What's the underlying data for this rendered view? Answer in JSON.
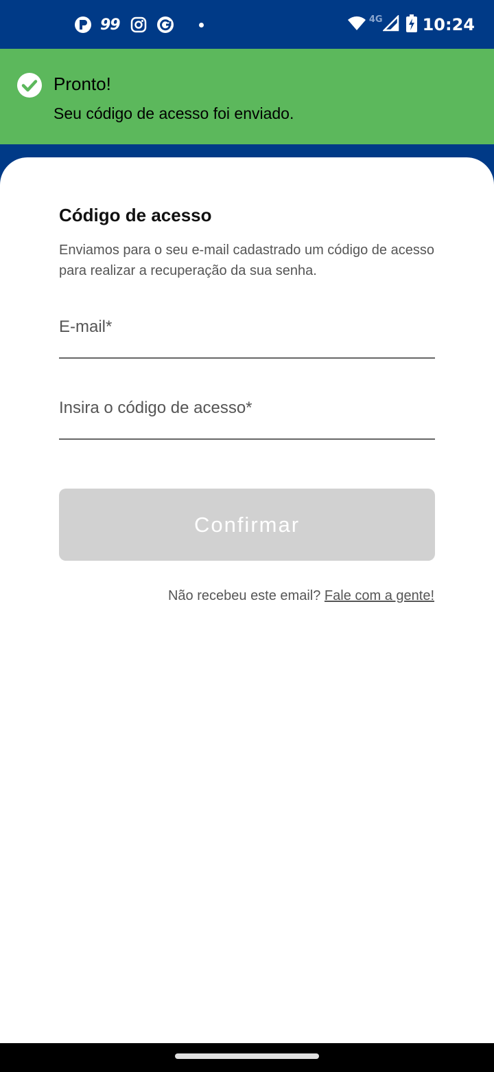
{
  "status_bar": {
    "app_99_label": "99",
    "network_label": "4G",
    "time": "10:24"
  },
  "toast": {
    "title": "Pronto!",
    "message": "Seu código de acesso foi enviado.",
    "color": "#5cb85c"
  },
  "form": {
    "title": "Código de acesso",
    "description": "Enviamos para o seu e-mail cadastrado um código de acesso para realizar a recuperação da sua senha.",
    "email_label": "E-mail*",
    "code_label": "Insira o código de acesso*",
    "confirm_label": "Confirmar",
    "help_text": "Não recebeu este email? ",
    "help_link": "Fale com a gente!"
  },
  "colors": {
    "brand_blue": "#003a87",
    "button_disabled": "#d1d1d1"
  }
}
